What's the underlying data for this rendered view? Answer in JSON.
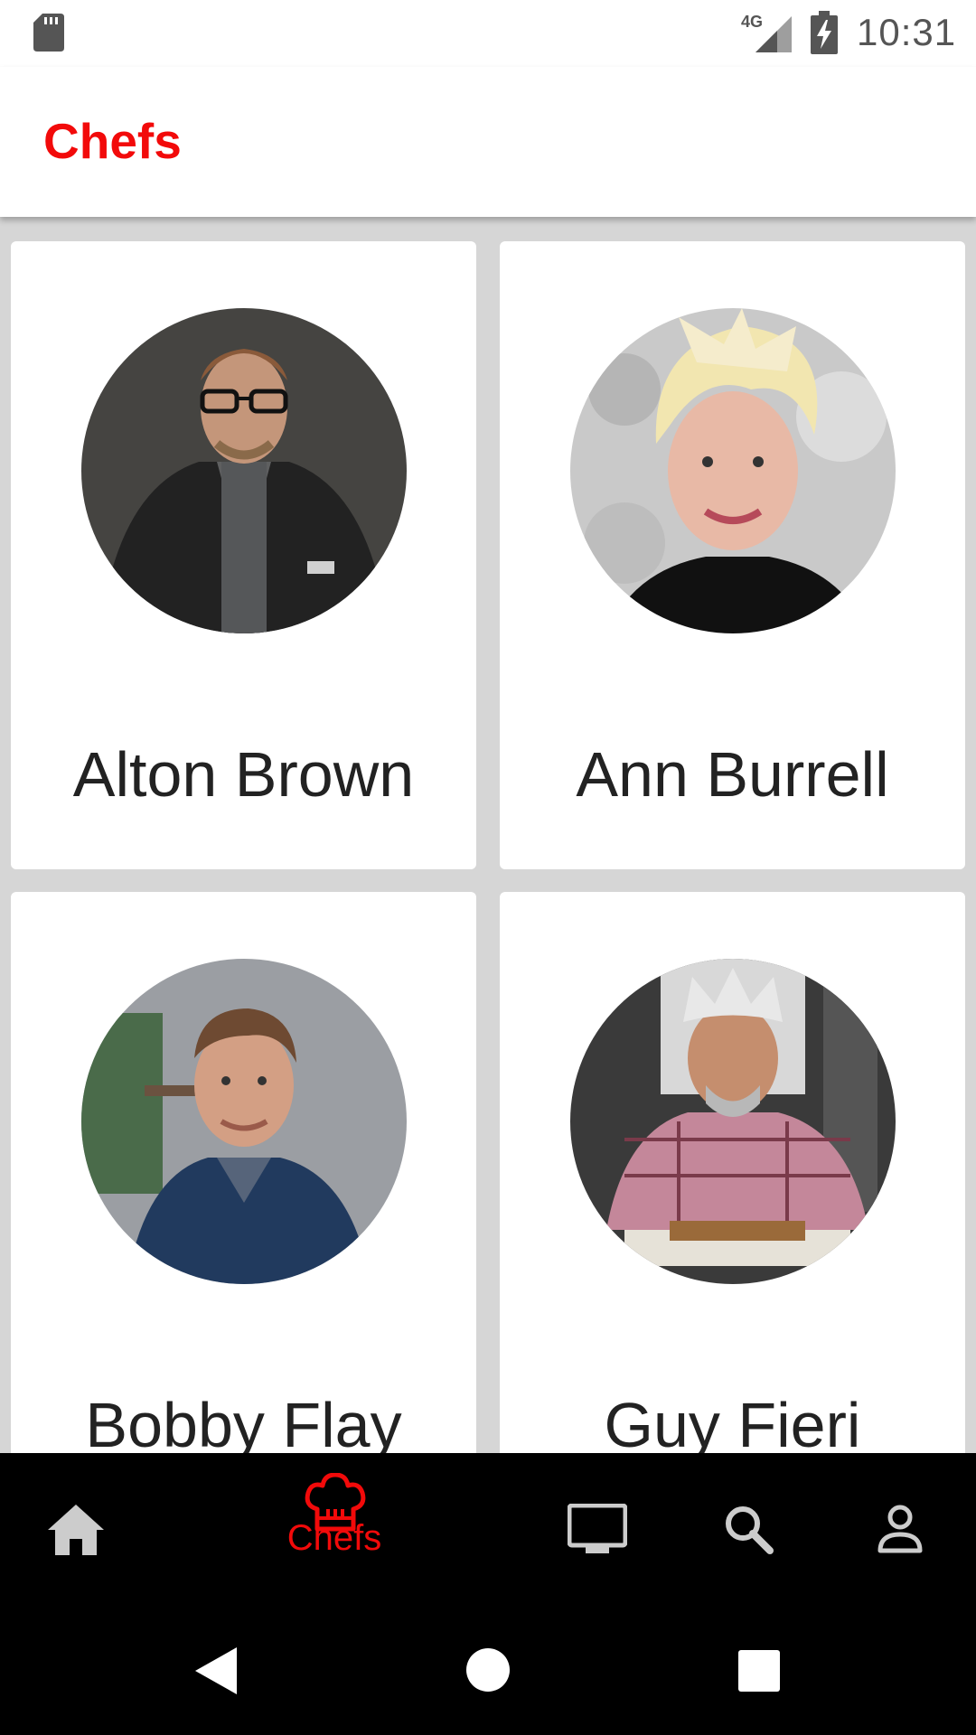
{
  "status_bar": {
    "time": "10:31",
    "network": "4G",
    "icons": [
      "sd-card-icon",
      "signal-icon",
      "battery-charging-icon"
    ]
  },
  "app_bar": {
    "title": "Chefs"
  },
  "chefs": [
    {
      "name": "Alton Brown"
    },
    {
      "name": "Ann Burrell"
    },
    {
      "name": "Bobby Flay"
    },
    {
      "name": "Guy Fieri"
    }
  ],
  "bottom_nav": {
    "items": [
      {
        "icon": "home-icon",
        "label": ""
      },
      {
        "icon": "chef-hat-icon",
        "label": "Chefs",
        "active": true
      },
      {
        "icon": "tv-icon",
        "label": ""
      },
      {
        "icon": "search-icon",
        "label": ""
      },
      {
        "icon": "profile-icon",
        "label": ""
      }
    ]
  },
  "system_nav": {
    "icons": [
      "back-icon",
      "home-circle-icon",
      "recents-icon"
    ]
  },
  "colors": {
    "accent": "#f20a0a",
    "background": "#d6d6d6",
    "nav_background": "#000000",
    "nav_inactive": "#cccccc"
  }
}
